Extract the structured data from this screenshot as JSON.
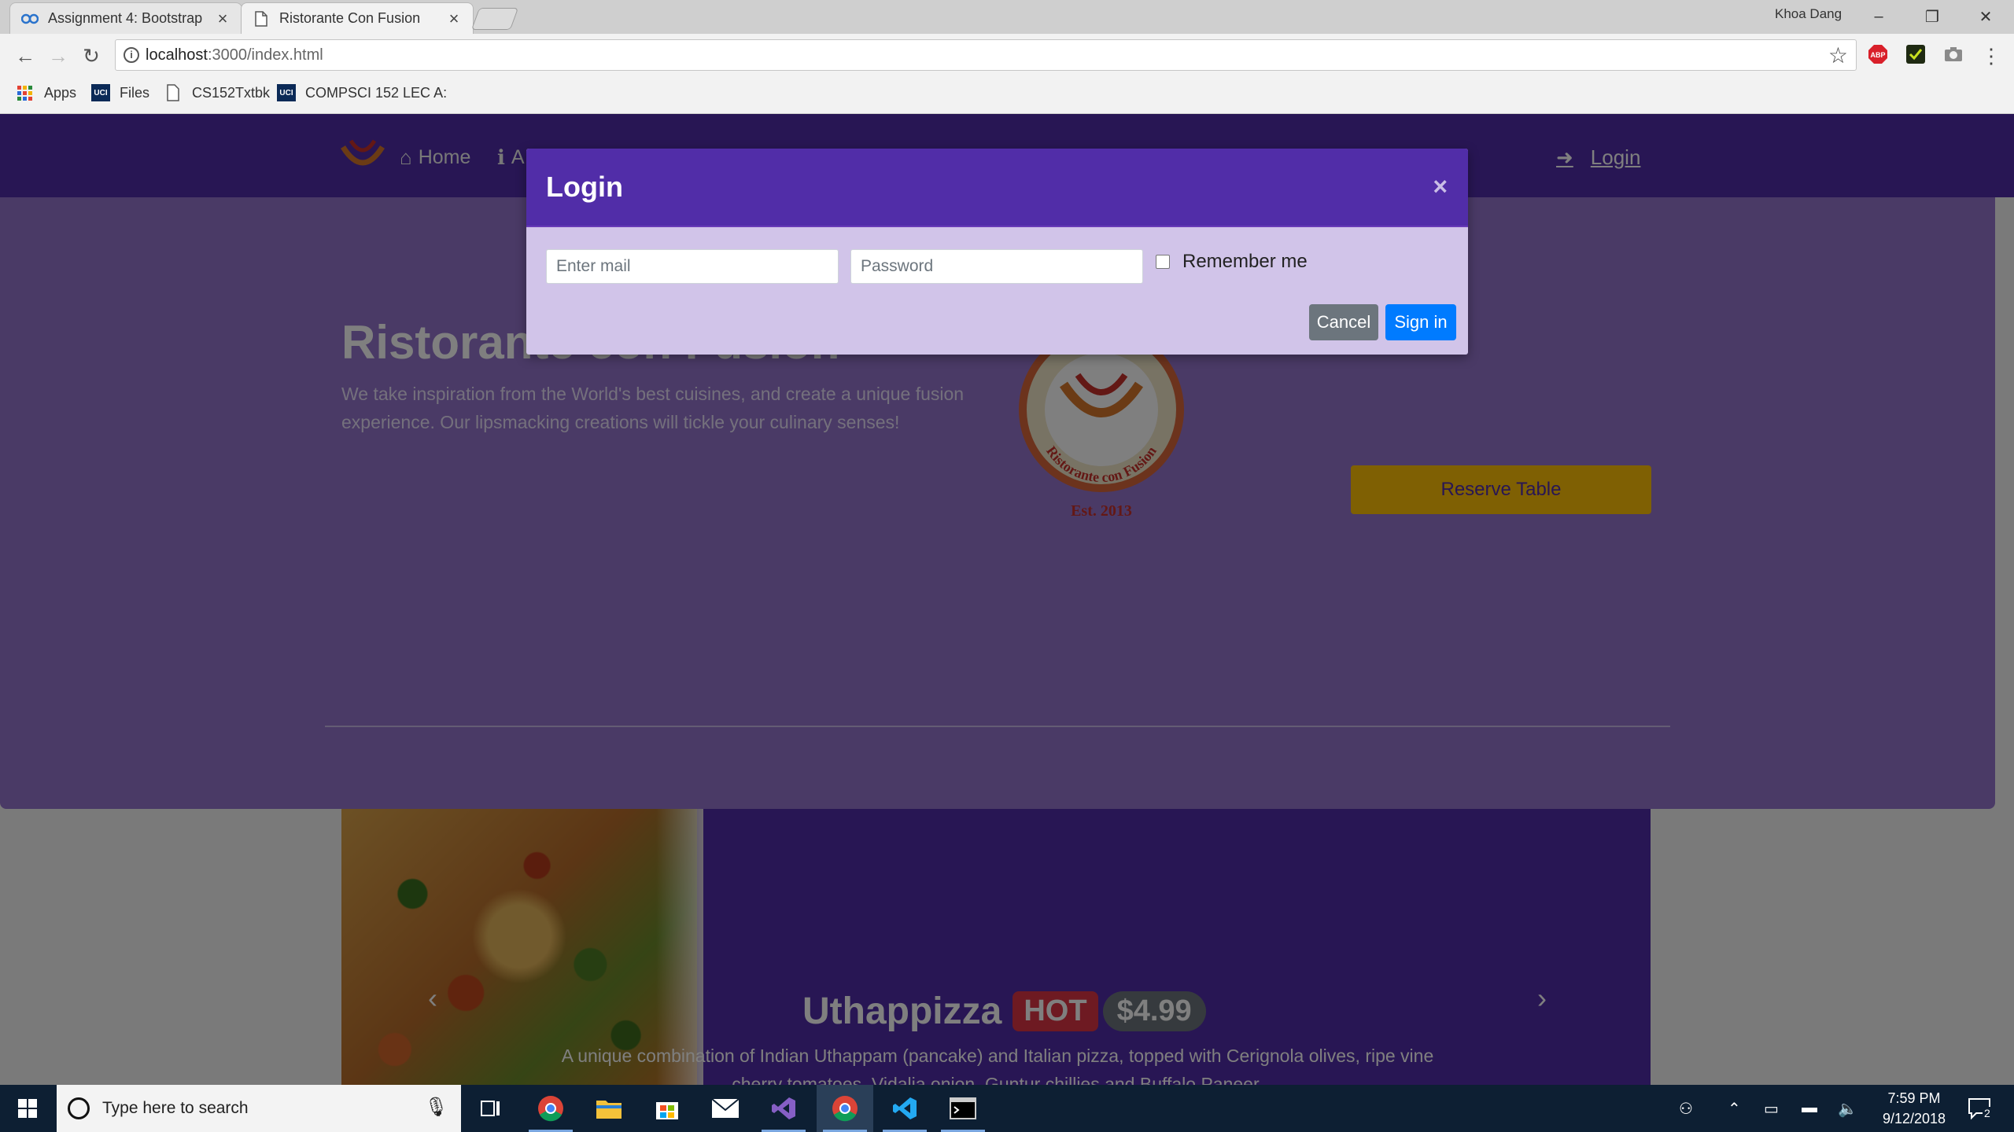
{
  "browser": {
    "tabs": [
      {
        "title": "Assignment 4: Bootstrap",
        "icon": "coursera-icon",
        "active": false
      },
      {
        "title": "Ristorante Con Fusion",
        "icon": "page-icon",
        "active": true
      }
    ],
    "user": "Khoa Dang",
    "url_host": "localhost",
    "url_rest": ":3000/index.html",
    "bookmarks": [
      {
        "label": "Apps",
        "icon": "apps-grid-icon"
      },
      {
        "label": "Files",
        "icon": "uci-icon"
      },
      {
        "label": "CS152Txtbk",
        "icon": "page-icon"
      },
      {
        "label": "COMPSCI 152 LEC A:",
        "icon": "uci-icon"
      }
    ]
  },
  "navbar": {
    "items": [
      {
        "label": "Home",
        "icon": "home-icon"
      },
      {
        "label": "A",
        "icon": "info-icon"
      }
    ],
    "login_label": "Login"
  },
  "jumbotron": {
    "title": "Ristorante con Fusion",
    "text": "We take inspiration from the World's best cuisines, and create a unique fusion experience. Our lipsmacking creations will tickle your culinary senses!",
    "logo_text": "Ristorante con Fusion",
    "logo_est": "Est. 2013",
    "reserve_label": "Reserve Table"
  },
  "carousel": {
    "dish_name": "Uthappizza",
    "badge": "HOT",
    "price": "$4.99",
    "description": "A unique combination of Indian Uthappam (pancake) and Italian pizza, topped with Cerignola olives, ripe vine cherry tomatoes, Vidalia onion, Guntur chillies and Buffalo Paneer."
  },
  "modal": {
    "title": "Login",
    "close_label": "×",
    "email_placeholder": "Enter mail",
    "password_placeholder": "Password",
    "remember_label": "Remember me",
    "cancel_label": "Cancel",
    "signin_label": "Sign in"
  },
  "taskbar": {
    "search_placeholder": "Type here to search",
    "time": "7:59 PM",
    "date": "9/12/2018",
    "notification_count": "2",
    "apps": [
      "task-view-icon",
      "chrome-icon",
      "file-explorer-icon",
      "store-icon",
      "mail-icon",
      "visual-studio-icon",
      "chrome-icon",
      "vscode-icon",
      "terminal-icon"
    ]
  },
  "colors": {
    "primary": "#512da8",
    "primary_light": "#9575cd",
    "modal_body": "#d1c4e9",
    "reserve": "#ffc107",
    "signin": "#007bff",
    "cancel": "#6c757d",
    "hot": "#dc3545"
  }
}
